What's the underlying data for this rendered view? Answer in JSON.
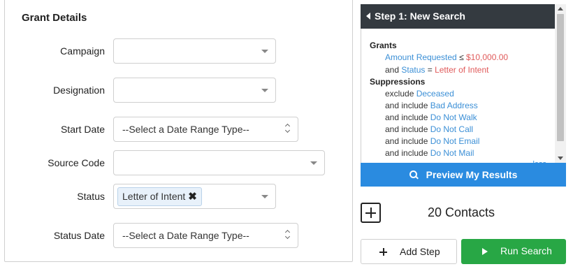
{
  "grant_details": {
    "title": "Grant Details",
    "fields": {
      "campaign": {
        "label": "Campaign",
        "value": ""
      },
      "designation": {
        "label": "Designation",
        "value": ""
      },
      "start_date": {
        "label": "Start Date",
        "value": "--Select a Date Range Type--"
      },
      "source_code": {
        "label": "Source Code",
        "value": ""
      },
      "status": {
        "label": "Status",
        "tag": "Letter of Intent",
        "remove_glyph": "✖"
      },
      "status_date": {
        "label": "Status Date",
        "value": "--Select a Date Range Type--"
      }
    }
  },
  "step_panel": {
    "header": "Step 1: New Search",
    "grants_heading": "Grants",
    "grants": [
      {
        "prefix": "",
        "field": "Amount Requested",
        "op": " ≤ ",
        "value": "$10,000.00"
      },
      {
        "prefix": "and ",
        "field": "Status",
        "op": " = ",
        "value": "Letter of Intent"
      }
    ],
    "suppressions_heading": "Suppressions",
    "suppressions": [
      {
        "prefix": "exclude ",
        "value": "Deceased"
      },
      {
        "prefix": "and include ",
        "value": "Bad Address"
      },
      {
        "prefix": "and include ",
        "value": "Do Not Walk"
      },
      {
        "prefix": "and include ",
        "value": "Do Not Call"
      },
      {
        "prefix": "and include ",
        "value": "Do Not Email"
      },
      {
        "prefix": "and include ",
        "value": "Do Not Mail"
      }
    ],
    "less_link": "less",
    "preview_button": "Preview My Results",
    "contacts": "20 Contacts",
    "add_step_button": "Add Step",
    "run_search_button": "Run Search"
  },
  "colors": {
    "header_bg": "#343a40",
    "preview_bg": "#2a8be0",
    "run_bg": "#28a745",
    "link_blue": "#3b8fd6",
    "value_red": "#e05a5a"
  }
}
